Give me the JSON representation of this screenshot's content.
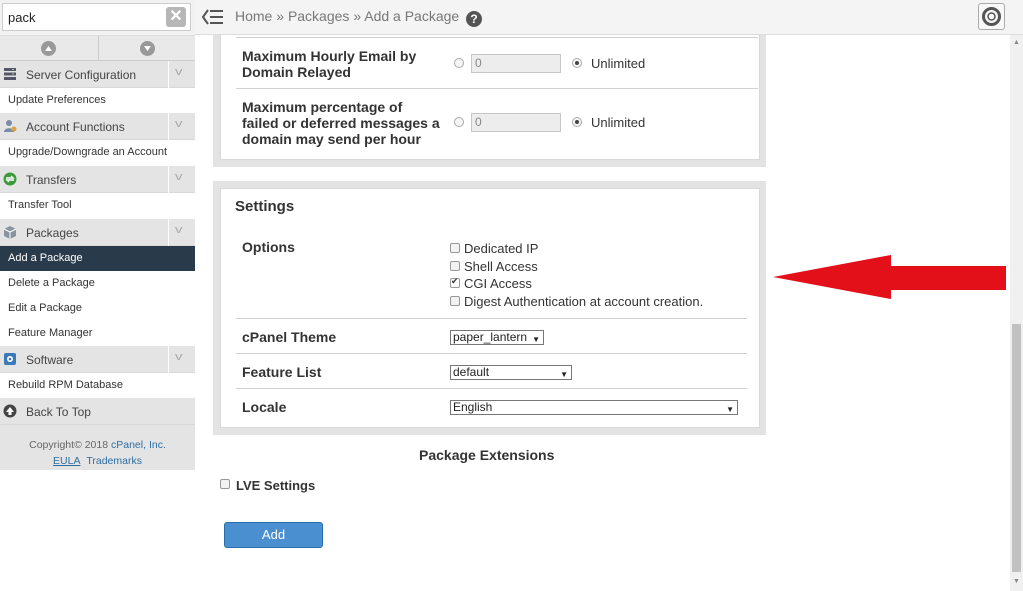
{
  "search": {
    "value": "pack",
    "clear": "✕"
  },
  "sidebar": {
    "categories": [
      {
        "label": "Server Configuration",
        "icon": "server-icon"
      },
      {
        "label": "Account Functions",
        "icon": "account-icon"
      },
      {
        "label": "Transfers",
        "icon": "transfers-icon"
      },
      {
        "label": "Packages",
        "icon": "packages-icon"
      },
      {
        "label": "Software",
        "icon": "software-icon"
      },
      {
        "label": "Back To Top",
        "icon": "back-to-top-icon"
      }
    ],
    "items": {
      "update_preferences": "Update Preferences",
      "upgrade_downgrade": "Upgrade/Downgrade an Account",
      "transfer_tool": "Transfer Tool",
      "add_package": "Add a Package",
      "delete_package": "Delete a Package",
      "edit_package": "Edit a Package",
      "feature_manager": "Feature Manager",
      "rebuild_rpm": "Rebuild RPM Database"
    },
    "copyright": {
      "text": "Copyright© 2018",
      "company": "cPanel, Inc.",
      "eula": "EULA",
      "trademarks": "Trademarks"
    }
  },
  "topbar": {
    "crumb_home": "Home",
    "sep": "»",
    "crumb_packages": "Packages",
    "crumb_current": "Add a Package",
    "help": "?"
  },
  "limits": {
    "hourly_label_1": "Maximum Hourly Email by",
    "hourly_label_2": "Domain Relayed",
    "hourly_value": "0",
    "hourly_unlimited": "Unlimited",
    "failed_label_1": "Maximum percentage of",
    "failed_label_2": "failed or deferred messages a",
    "failed_label_3": "domain may send per hour",
    "failed_value": "0",
    "failed_unlimited": "Unlimited"
  },
  "settings": {
    "title": "Settings",
    "options_label": "Options",
    "options": [
      {
        "label": "Dedicated IP",
        "checked": false
      },
      {
        "label": "Shell Access",
        "checked": false
      },
      {
        "label": "CGI Access",
        "checked": true
      },
      {
        "label": "Digest Authentication at account creation.",
        "checked": false
      }
    ],
    "theme_label": "cPanel Theme",
    "theme_value": "paper_lantern",
    "feature_list_label": "Feature List",
    "feature_list_value": "default",
    "locale_label": "Locale",
    "locale_value": "English"
  },
  "extensions": {
    "title": "Package Extensions",
    "lve_label": "LVE Settings"
  },
  "add_button": "Add",
  "colors": {
    "active_nav": "#293a4a",
    "primary_button": "#4a8fd0",
    "annotation_arrow": "#e3101a"
  }
}
